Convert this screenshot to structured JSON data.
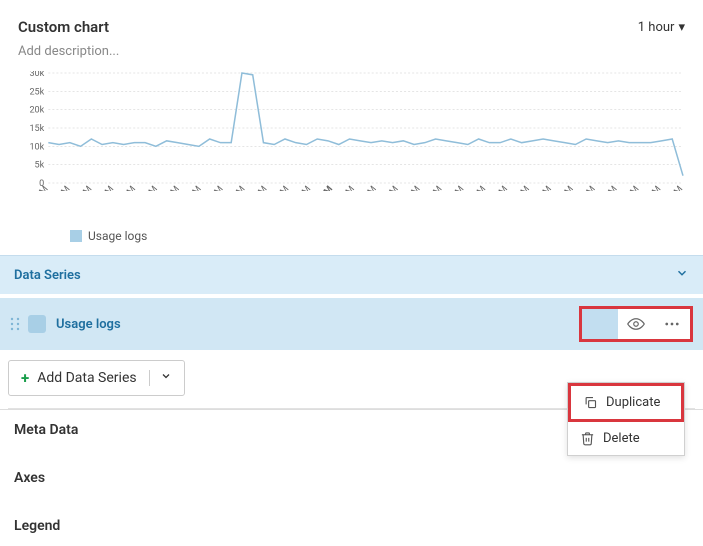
{
  "header": {
    "title": "Custom chart",
    "time_range": "1 hour"
  },
  "description_placeholder": "Add description...",
  "chart_data": {
    "type": "line",
    "title": "",
    "xlabel": "",
    "ylabel": "",
    "ylim": [
      0,
      30000
    ],
    "y_ticks": [
      "0",
      "5k",
      "10k",
      "15k",
      "20k",
      "25k",
      "30k"
    ],
    "x_ticks": [
      "6:34 AM",
      "6:36 AM",
      "6:38 AM",
      "6:40 AM",
      "6:42 AM",
      "6:44 AM",
      "6:46 AM",
      "6:48 AM",
      "6:50 AM",
      "6:52 AM",
      "6:54 AM",
      "6:56 AM",
      "6:58 AM",
      "7AM",
      "7:02 AM",
      "7:04 AM",
      "7:06 AM",
      "7:08 AM",
      "7:10 AM",
      "7:12 AM",
      "7:14 AM",
      "7:16 AM",
      "7:19 AM",
      "7:21 AM",
      "7:23 AM",
      "7:25 AM",
      "7:27 AM",
      "7:29 AM",
      "7:31 AM",
      "7:33 AM"
    ],
    "series": [
      {
        "name": "Usage logs",
        "values": [
          11000,
          10500,
          11000,
          10000,
          12000,
          10500,
          11000,
          10500,
          11000,
          11000,
          10000,
          11500,
          11000,
          10500,
          10000,
          12000,
          11000,
          11000,
          30000,
          29500,
          11000,
          10500,
          12000,
          11000,
          10500,
          12000,
          11500,
          10500,
          12000,
          11500,
          11000,
          11500,
          11000,
          11500,
          10500,
          11000,
          12000,
          11500,
          11000,
          10500,
          12000,
          11000,
          11000,
          12000,
          11000,
          11500,
          12000,
          11500,
          11000,
          10500,
          12000,
          11500,
          11000,
          11500,
          11000,
          11000,
          11000,
          11500,
          12000,
          2000
        ]
      }
    ]
  },
  "sections": {
    "data_series": {
      "label": "Data Series",
      "expanded": true
    },
    "meta_data": {
      "label": "Meta Data"
    },
    "axes": {
      "label": "Axes"
    },
    "legend": {
      "label": "Legend"
    }
  },
  "series_list": [
    {
      "name": "Usage logs",
      "color": "#a8cfe6"
    }
  ],
  "add_button": {
    "label": "Add Data Series"
  },
  "context_menu": {
    "duplicate": "Duplicate",
    "delete": "Delete"
  },
  "legend_label": "Usage logs",
  "icons": {
    "eye": "eye-icon",
    "more": "more-icon",
    "duplicate": "duplicate-icon",
    "delete": "delete-icon",
    "caret": "caret-down-icon",
    "chevron": "chevron-down-icon",
    "plus": "plus-icon",
    "drag": "drag-handle-icon"
  }
}
